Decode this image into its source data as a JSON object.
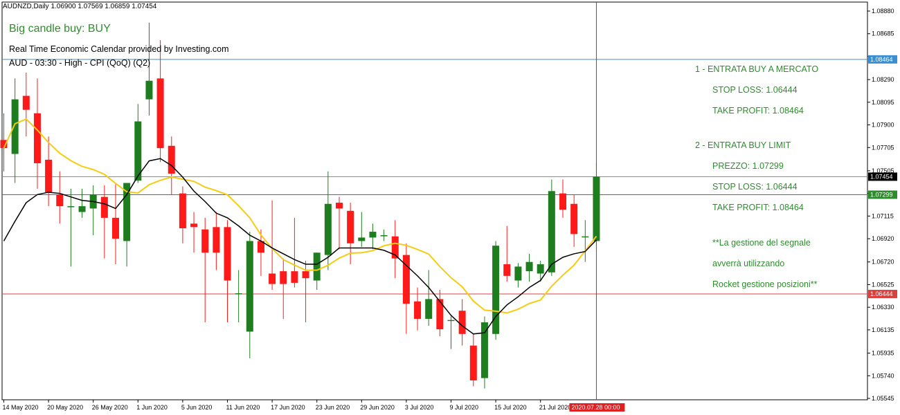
{
  "header": {
    "symbol_info": "AUDNZD,Daily  1.06900 1.07569 1.06859 1.07454",
    "signal": "Big candle buy: BUY",
    "calendar_line1": "Real Time Economic Calendar provided by Investing.com",
    "calendar_line2": "AUD - 03:30 - High - CPI (QoQ) (Q2)"
  },
  "annotations": {
    "l1": "1 - ENTRATA BUY A MERCATO",
    "l2": "STOP LOSS: 1.06444",
    "l3": "TAKE PROFIT: 1.08464",
    "l4": "2 - ENTRATA BUY LIMIT",
    "l5": "PREZZO: 1.07299",
    "l6": "STOP LOSS: 1.06444",
    "l7": "TAKE PROFIT: 1.08464",
    "l8": "**La gestione del segnale",
    "l9": "avverrà utilizzando",
    "l10": "Rocket gestione posizioni**"
  },
  "colors": {
    "bull": "#1e7d1e",
    "bear": "#ff1a1a",
    "ma_fast": "#000000",
    "ma_slow": "#f4cc14",
    "take_profit_line": "#3a8fd0",
    "current_price_line": "#8c8c8c",
    "entry_line": "#2e8b2e",
    "stop_loss_line": "#d94040",
    "vline": "#b03030",
    "ann_text": "#2e8b2e"
  },
  "chart_data": {
    "type": "candlestick",
    "symbol": "AUDNZD",
    "timeframe": "Daily",
    "y_ticks": [
      1.05545,
      1.0574,
      1.05935,
      1.06135,
      1.0633,
      1.06525,
      1.0672,
      1.0692,
      1.07115,
      1.0731,
      1.07505,
      1.07705,
      1.079,
      1.08095,
      1.0829,
      1.0849,
      1.08685,
      1.0888
    ],
    "y_tick_labels": [
      "1.05545",
      "1.05740",
      "1.05935",
      "1.06135",
      "1.06330",
      "1.06525",
      "1.06720",
      "1.06920",
      "1.07115",
      "",
      "1.07505",
      "1.07705",
      "1.07900",
      "1.08095",
      "1.08290",
      "",
      "1.08685",
      "1.08880"
    ],
    "x_labels": [
      {
        "bar": 0,
        "label": "14 May 2020"
      },
      {
        "bar": 4,
        "label": "20 May 2020"
      },
      {
        "bar": 8,
        "label": "26 May 2020"
      },
      {
        "bar": 12,
        "label": "1 Jun 2020"
      },
      {
        "bar": 16,
        "label": "5 Jun 2020"
      },
      {
        "bar": 20,
        "label": "11 Jun 2020"
      },
      {
        "bar": 24,
        "label": "17 Jun 2020"
      },
      {
        "bar": 28,
        "label": "23 Jun 2020"
      },
      {
        "bar": 32,
        "label": "29 Jun 2020"
      },
      {
        "bar": 36,
        "label": "3 Jul 2020"
      },
      {
        "bar": 40,
        "label": "9 Jul 2020"
      },
      {
        "bar": 44,
        "label": "15 Jul 2020"
      },
      {
        "bar": 48,
        "label": "21 Jul 2020"
      }
    ],
    "cursor_label": "2020.07.28 00:00",
    "cursor_bar": 53,
    "h_lines": [
      {
        "price": 1.08464,
        "label": "1.08464",
        "role": "take_profit"
      },
      {
        "price": 1.07454,
        "label": "1.07454",
        "role": "current_price"
      },
      {
        "price": 1.07299,
        "label": "1.07299",
        "role": "entry"
      },
      {
        "price": 1.06444,
        "label": "1.06444",
        "role": "stop_loss"
      }
    ],
    "candles": [
      {
        "o": 1.0777,
        "h": 1.08,
        "l": 1.075,
        "c": 1.077
      },
      {
        "o": 1.0765,
        "h": 1.083,
        "l": 1.074,
        "c": 1.0812
      },
      {
        "o": 1.0815,
        "h": 1.0835,
        "l": 1.078,
        "c": 1.0803
      },
      {
        "o": 1.08,
        "h": 1.083,
        "l": 1.0735,
        "c": 1.0757
      },
      {
        "o": 1.076,
        "h": 1.078,
        "l": 1.072,
        "c": 1.0732
      },
      {
        "o": 1.073,
        "h": 1.075,
        "l": 1.0705,
        "c": 1.072
      },
      {
        "o": 1.072,
        "h": 1.0735,
        "l": 1.0668,
        "c": 1.072
      },
      {
        "o": 1.0715,
        "h": 1.0735,
        "l": 1.071,
        "c": 1.072
      },
      {
        "o": 1.0718,
        "h": 1.0738,
        "l": 1.0695,
        "c": 1.073
      },
      {
        "o": 1.0728,
        "h": 1.0738,
        "l": 1.0675,
        "c": 1.071
      },
      {
        "o": 1.071,
        "h": 1.074,
        "l": 1.067,
        "c": 1.0692
      },
      {
        "o": 1.069,
        "h": 1.0725,
        "l": 1.0668,
        "c": 1.074
      },
      {
        "o": 1.0742,
        "h": 1.0808,
        "l": 1.074,
        "c": 1.0793
      },
      {
        "o": 1.0812,
        "h": 1.0878,
        "l": 1.0798,
        "c": 1.0828
      },
      {
        "o": 1.083,
        "h": 1.0863,
        "l": 1.0758,
        "c": 1.077
      },
      {
        "o": 1.0772,
        "h": 1.078,
        "l": 1.073,
        "c": 1.0748
      },
      {
        "o": 1.0731,
        "h": 1.0737,
        "l": 1.0688,
        "c": 1.0701
      },
      {
        "o": 1.0705,
        "h": 1.0715,
        "l": 1.068,
        "c": 1.0702
      },
      {
        "o": 1.07,
        "h": 1.071,
        "l": 1.062,
        "c": 1.068
      },
      {
        "o": 1.0702,
        "h": 1.0715,
        "l": 1.0665,
        "c": 1.068
      },
      {
        "o": 1.0702,
        "h": 1.0708,
        "l": 1.062,
        "c": 1.0656
      },
      {
        "o": 1.0645,
        "h": 1.0665,
        "l": 1.062,
        "c": 1.0645
      },
      {
        "o": 1.0612,
        "h": 1.0698,
        "l": 1.0589,
        "c": 1.069
      },
      {
        "o": 1.069,
        "h": 1.07,
        "l": 1.066,
        "c": 1.068
      },
      {
        "o": 1.0662,
        "h": 1.0725,
        "l": 1.0648,
        "c": 1.0653
      },
      {
        "o": 1.0664,
        "h": 1.0675,
        "l": 1.0623,
        "c": 1.0653
      },
      {
        "o": 1.0664,
        "h": 1.071,
        "l": 1.065,
        "c": 1.0654
      },
      {
        "o": 1.0664,
        "h": 1.0673,
        "l": 1.062,
        "c": 1.0658
      },
      {
        "o": 1.0656,
        "h": 1.068,
        "l": 1.0648,
        "c": 1.068
      },
      {
        "o": 1.0678,
        "h": 1.075,
        "l": 1.0665,
        "c": 1.0722
      },
      {
        "o": 1.0723,
        "h": 1.0728,
        "l": 1.0683,
        "c": 1.0718
      },
      {
        "o": 1.0716,
        "h": 1.0723,
        "l": 1.067,
        "c": 1.0688
      },
      {
        "o": 1.069,
        "h": 1.0715,
        "l": 1.0685,
        "c": 1.0693
      },
      {
        "o": 1.0693,
        "h": 1.0705,
        "l": 1.0683,
        "c": 1.0698
      },
      {
        "o": 1.0695,
        "h": 1.07,
        "l": 1.069,
        "c": 1.0695
      },
      {
        "o": 1.0694,
        "h": 1.0708,
        "l": 1.0658,
        "c": 1.0675
      },
      {
        "o": 1.0678,
        "h": 1.0688,
        "l": 1.061,
        "c": 1.0636
      },
      {
        "o": 1.0638,
        "h": 1.065,
        "l": 1.0613,
        "c": 1.0623
      },
      {
        "o": 1.0623,
        "h": 1.0665,
        "l": 1.0617,
        "c": 1.064
      },
      {
        "o": 1.064,
        "h": 1.0648,
        "l": 1.0608,
        "c": 1.0614
      },
      {
        "o": 1.0622,
        "h": 1.0625,
        "l": 1.0597,
        "c": 1.0622
      },
      {
        "o": 1.063,
        "h": 1.064,
        "l": 1.06,
        "c": 1.061
      },
      {
        "o": 1.06,
        "h": 1.061,
        "l": 1.0565,
        "c": 1.057
      },
      {
        "o": 1.0572,
        "h": 1.0625,
        "l": 1.0563,
        "c": 1.062
      },
      {
        "o": 1.061,
        "h": 1.069,
        "l": 1.0605,
        "c": 1.0686
      },
      {
        "o": 1.067,
        "h": 1.0703,
        "l": 1.0655,
        "c": 1.066
      },
      {
        "o": 1.0656,
        "h": 1.0671,
        "l": 1.065,
        "c": 1.0668
      },
      {
        "o": 1.0664,
        "h": 1.0679,
        "l": 1.0655,
        "c": 1.0672
      },
      {
        "o": 1.0662,
        "h": 1.0673,
        "l": 1.0655,
        "c": 1.067
      },
      {
        "o": 1.0663,
        "h": 1.0743,
        "l": 1.066,
        "c": 1.0733
      },
      {
        "o": 1.0731,
        "h": 1.0743,
        "l": 1.071,
        "c": 1.0717
      },
      {
        "o": 1.0722,
        "h": 1.073,
        "l": 1.0685,
        "c": 1.0696
      },
      {
        "o": 1.0694,
        "h": 1.0708,
        "l": 1.0672,
        "c": 1.0694
      },
      {
        "o": 1.069,
        "h": 1.0757,
        "l": 1.0686,
        "c": 1.07454
      }
    ],
    "ma_fast": [
      1.069,
      1.0707,
      1.0723,
      1.073,
      1.0732,
      1.0731,
      1.0728,
      1.0725,
      1.0724,
      1.0722,
      1.0718,
      1.073,
      1.0746,
      1.0759,
      1.0761,
      1.0755,
      1.0745,
      1.0733,
      1.0724,
      1.0714,
      1.071,
      1.0703,
      1.0695,
      1.069,
      1.0684,
      1.0679,
      1.0674,
      1.067,
      1.067,
      1.0676,
      1.0684,
      1.0684,
      1.0684,
      1.0684,
      1.0682,
      1.0678,
      1.0669,
      1.066,
      1.065,
      1.0638,
      1.0626,
      1.0617,
      1.061,
      1.0611,
      1.0625,
      1.0635,
      1.0642,
      1.065,
      1.0656,
      1.067,
      1.0676,
      1.0679,
      1.0681,
      1.0691
    ]
  }
}
